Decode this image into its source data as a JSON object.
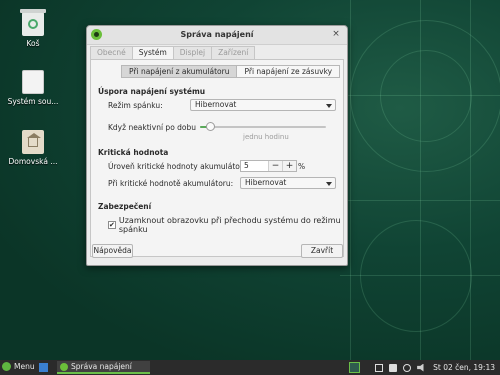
{
  "desktop": {
    "icons": [
      {
        "label": "Koš"
      },
      {
        "label": "Systém sou..."
      },
      {
        "label": "Domovská ..."
      }
    ]
  },
  "window": {
    "title": "Správa napájení",
    "close_glyph": "×",
    "tabs": [
      "Obecné",
      "Systém",
      "Displej",
      "Zařízení"
    ],
    "active_tab": "Systém",
    "power_source": {
      "options": [
        "Při napájení z akumulátoru",
        "Při napájení ze zásuvky"
      ],
      "selected": "Při napájení z akumulátoru"
    },
    "system_power_saving": {
      "heading": "Úspora napájení systému",
      "sleep_mode_label": "Režim spánku:",
      "sleep_mode_value": "Hibernovat",
      "inactive_label": "Když neaktivní po dobu",
      "inactive_value_caption": "jednu hodinu",
      "inactive_slider_fraction": 0.08
    },
    "critical_level": {
      "heading": "Kritická hodnota",
      "level_label": "Úroveň kritické hodnoty akumulátoru:",
      "level_value": "5",
      "minus": "−",
      "plus": "+",
      "unit": "%",
      "action_label": "Při kritické hodnotě akumulátoru:",
      "action_value": "Hibernovat"
    },
    "security": {
      "heading": "Zabezpečení",
      "lock_label": "Uzamknout obrazovku při přechodu systému do režimu spánku",
      "lock_checked": true,
      "check_glyph": "✔"
    },
    "help_button": "Nápověda",
    "close_button": "Zavřít"
  },
  "taskbar": {
    "menu_label": "Menu",
    "task_label": "Správa napájení",
    "clock": "St 02 čen, 19:13"
  },
  "colors": {
    "accent": "#6abf49",
    "desktop_bg": "#0c3a2c",
    "taskbar_bg": "#2b2b2b"
  }
}
